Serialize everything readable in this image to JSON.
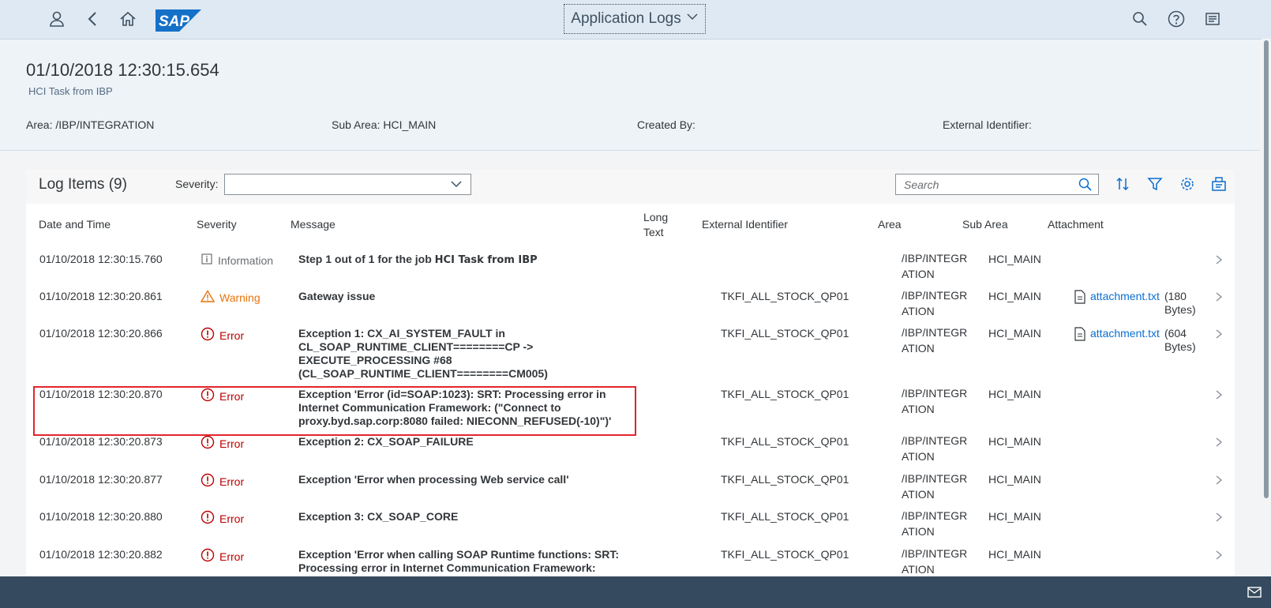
{
  "shell": {
    "logo_text": "SAP",
    "app_title": "Application Logs"
  },
  "header": {
    "title": "01/10/2018 12:30:15.654",
    "subtitle": "HCI Task from IBP",
    "attributes": [
      {
        "label": "Area:",
        "value": "/IBP/INTEGRATION"
      },
      {
        "label": "Sub Area:",
        "value": "HCI_MAIN"
      },
      {
        "label": "Created By:",
        "value": ""
      },
      {
        "label": "External Identifier:",
        "value": ""
      }
    ]
  },
  "toolbar": {
    "title": "Log Items (9)",
    "severity_label": "Severity:",
    "severity_value": "",
    "search_placeholder": "Search"
  },
  "columns": {
    "date": "Date and Time",
    "severity": "Severity",
    "message": "Message",
    "long_text_1": "Long",
    "long_text_2": "Text",
    "ext": "External Identifier",
    "area": "Area",
    "sub": "Sub Area",
    "attachment": "Attachment"
  },
  "rows": [
    {
      "date": "01/10/2018 12:30:15.760",
      "severity": "Information",
      "level": "info",
      "message": "Step 1 out of 1 for the job",
      "message_job": "HCI Task from IBP",
      "ext": "",
      "area_1": "/IBP/INTEGR",
      "area_2": "ATION",
      "sub": "HCI_MAIN",
      "att_name": "",
      "att_size_1": "",
      "att_size_2": ""
    },
    {
      "date": "01/10/2018 12:30:20.861",
      "severity": "Warning",
      "level": "warn",
      "message": "Gateway issue",
      "message_job": "",
      "ext": "TKFI_ALL_STOCK_QP01",
      "area_1": "/IBP/INTEGR",
      "area_2": "ATION",
      "sub": "HCI_MAIN",
      "att_name": "attachment.txt",
      "att_size_1": "(180",
      "att_size_2": "Bytes)"
    },
    {
      "date": "01/10/2018 12:30:20.866",
      "severity": "Error",
      "level": "err",
      "message": "Exception 1: CX_AI_SYSTEM_FAULT in CL_SOAP_RUNTIME_CLIENT========CP -> EXECUTE_PROCESSING #68 (CL_SOAP_RUNTIME_CLIENT========CM005)",
      "message_job": "",
      "ext": "TKFI_ALL_STOCK_QP01",
      "area_1": "/IBP/INTEGR",
      "area_2": "ATION",
      "sub": "HCI_MAIN",
      "att_name": "attachment.txt",
      "att_size_1": "(604",
      "att_size_2": "Bytes)"
    },
    {
      "date": "01/10/2018 12:30:20.870",
      "severity": "Error",
      "level": "err",
      "message": "Exception 'Error (id=SOAP:1023): SRT: Processing error in Internet Communication Framework: (\"Connect to proxy.byd.sap.corp:8080 failed: NIECONN_REFUSED(-10)\")'",
      "message_job": "",
      "ext": "TKFI_ALL_STOCK_QP01",
      "area_1": "/IBP/INTEGR",
      "area_2": "ATION",
      "sub": "HCI_MAIN",
      "att_name": "",
      "att_size_1": "",
      "att_size_2": ""
    },
    {
      "date": "01/10/2018 12:30:20.873",
      "severity": "Error",
      "level": "err",
      "message": "Exception 2: CX_SOAP_FAILURE",
      "message_job": "",
      "ext": "TKFI_ALL_STOCK_QP01",
      "area_1": "/IBP/INTEGR",
      "area_2": "ATION",
      "sub": "HCI_MAIN",
      "att_name": "",
      "att_size_1": "",
      "att_size_2": ""
    },
    {
      "date": "01/10/2018 12:30:20.877",
      "severity": "Error",
      "level": "err",
      "message": "Exception 'Error when processing Web service call'",
      "message_job": "",
      "ext": "TKFI_ALL_STOCK_QP01",
      "area_1": "/IBP/INTEGR",
      "area_2": "ATION",
      "sub": "HCI_MAIN",
      "att_name": "",
      "att_size_1": "",
      "att_size_2": ""
    },
    {
      "date": "01/10/2018 12:30:20.880",
      "severity": "Error",
      "level": "err",
      "message": "Exception 3: CX_SOAP_CORE",
      "message_job": "",
      "ext": "TKFI_ALL_STOCK_QP01",
      "area_1": "/IBP/INTEGR",
      "area_2": "ATION",
      "sub": "HCI_MAIN",
      "att_name": "",
      "att_size_1": "",
      "att_size_2": ""
    },
    {
      "date": "01/10/2018 12:30:20.882",
      "severity": "Error",
      "level": "err",
      "message": "Exception 'Error when calling SOAP Runtime functions: SRT: Processing error in Internet Communication Framework:",
      "message_job": "",
      "ext": "TKFI_ALL_STOCK_QP01",
      "area_1": "/IBP/INTEGR",
      "area_2": "ATION",
      "sub": "HCI_MAIN",
      "att_name": "",
      "att_size_1": "",
      "att_size_2": ""
    }
  ],
  "colors": {
    "shell": "#dfe9f3",
    "link": "#0a6ed1",
    "error": "#bb0000",
    "warning": "#e9730c",
    "highlight": "#e3252d",
    "footer": "#354a5f"
  }
}
